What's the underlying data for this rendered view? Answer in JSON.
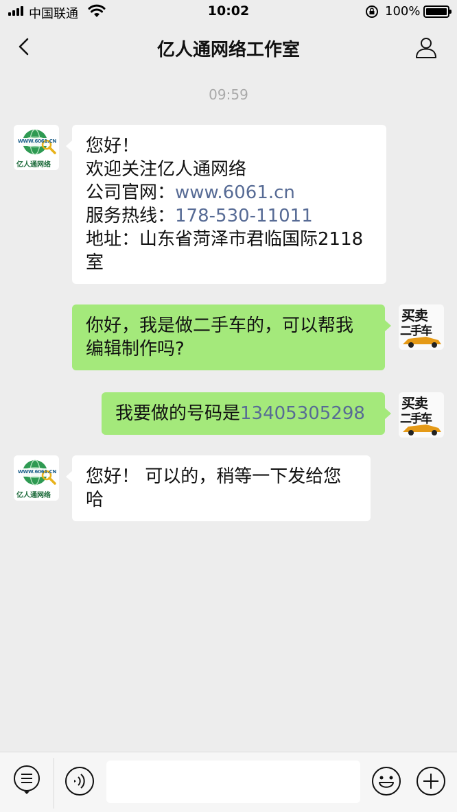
{
  "status_bar": {
    "carrier": "中国联通",
    "time": "10:02",
    "battery": "100%"
  },
  "nav": {
    "title": "亿人通网络工作室",
    "back_icon": "chevron-left-icon",
    "profile_icon": "person-icon"
  },
  "timestamp": "09:59",
  "contact_avatar": {
    "url_text": "WWW.6061.CN",
    "name_text": "亿人通网络"
  },
  "my_avatar": {
    "line1": "买卖",
    "line2": "二手车"
  },
  "messages": {
    "msg1": {
      "line1": "您好！",
      "line2": "欢迎关注亿人通网络",
      "line3_label": "公司官网：",
      "line3_link": "www.6061.cn",
      "line4_label": "服务热线：",
      "line4_link": "178-530-11011",
      "line5": "地址：山东省菏泽市君临国际2118",
      "line6": "室"
    },
    "msg2": {
      "line1": "你好，我是做二手车的，可以帮我",
      "line2": "编辑制作吗?"
    },
    "msg3": {
      "text": "我要做的号码是",
      "link": "13405305298"
    },
    "msg4": {
      "line1": "您好！ 可以的，稍等一下发给您",
      "line2": "哈"
    }
  },
  "input_bar": {
    "placeholder": "",
    "menu_icon": "list-menu-icon",
    "voice_icon": "voice-icon",
    "emoji_icon": "emoji-icon",
    "add_icon": "plus-icon"
  },
  "colors": {
    "background": "#ededed",
    "incoming_bubble": "#ffffff",
    "outgoing_bubble": "#a4e97b",
    "link": "#576b95",
    "timestamp": "#a9a9a9"
  }
}
